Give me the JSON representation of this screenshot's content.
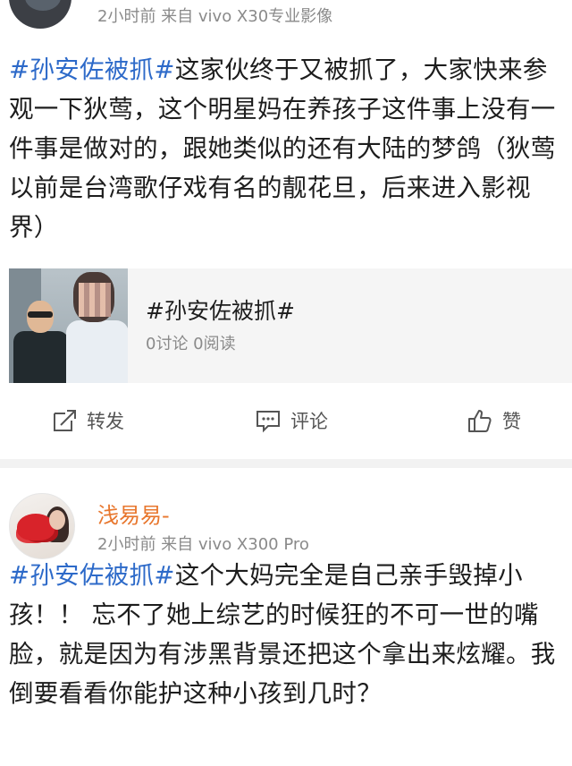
{
  "post1": {
    "meta": "2小时前 来自 vivo X30专业影像",
    "hashtag": "#孙安佐被抓#",
    "text": "这家伙终于又被抓了，大家快来参观一下狄莺，这个明星妈在养孩子这件事上没有一件事是做对的，跟她类似的还有大陆的梦鸽（狄莺以前是台湾歌仔戏有名的靓花旦，后来进入影视界）",
    "topic_card": {
      "title": "#孙安佐被抓#",
      "stats": "0讨论 0阅读"
    },
    "actions": {
      "repost": "转发",
      "comment": "评论",
      "like": "赞"
    }
  },
  "post2": {
    "username": "浅易易-",
    "meta": "2小时前 来自 vivo X300 Pro",
    "hashtag": "#孙安佐被抓#",
    "text": "这个大妈完全是自己亲手毁掉小孩！！ 忘不了她上综艺的时候狂的不可一世的嘴脸，就是因为有涉黑背景还把这个拿出来炫耀。我倒要看看你能护这种小孩到几时？"
  },
  "colors": {
    "hashtag": "#2d6ac9",
    "username": "#e8772e",
    "meta_gray": "#8a8a8a"
  }
}
